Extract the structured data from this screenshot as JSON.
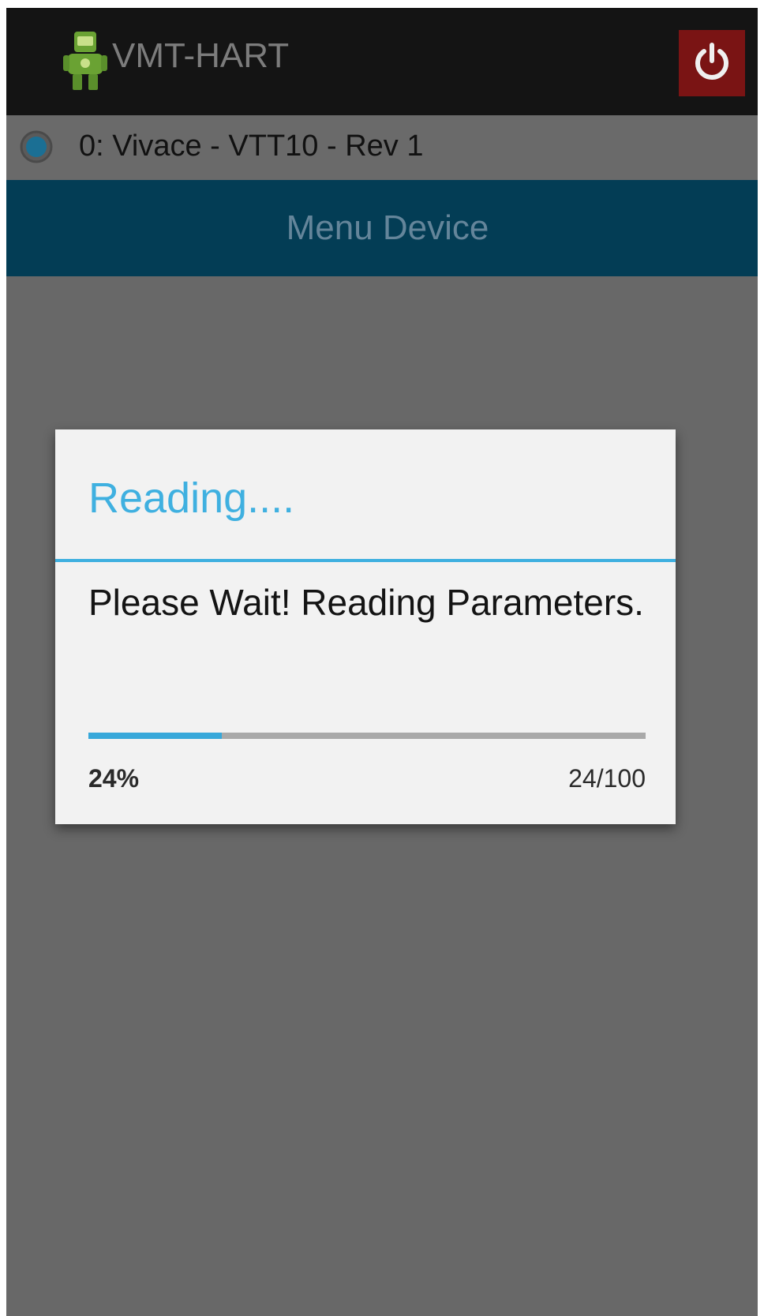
{
  "action_bar": {
    "title": "VMT-HART",
    "app_icon": "robot-app-icon",
    "power_icon": "power-icon"
  },
  "device": {
    "label": "0: Vivace - VTT10 - Rev 1",
    "selected": true
  },
  "menu": {
    "title": "Menu Device"
  },
  "dialog": {
    "title": "Reading....",
    "message": "Please Wait! Reading Parameters.",
    "progress_fraction": 0.24,
    "progress_percent_label": "24%",
    "progress_count_label": "24/100"
  },
  "colors": {
    "accent": "#3fb0e0",
    "header": "#033d55",
    "power_button": "#7a1414"
  }
}
